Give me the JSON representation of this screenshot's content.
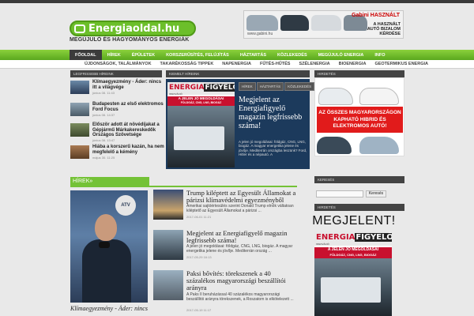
{
  "header": {
    "logo_text": "Energiaoldal.hu",
    "tagline": "MEGÚJULÓ ÉS HAGYOMÁNYOS ENERGIÁK",
    "ad": {
      "brand": "Gabini HASZNÁLT",
      "url": "www.gabini.hu",
      "slogan": "A HASZNÁLT AUTÓ BIZALOM KÉRDÉSE"
    }
  },
  "nav": {
    "items": [
      "FŐOLDAL",
      "HÍREK",
      "ÉPÜLETEK",
      "KORSZERŰSÍTÉS, FELÚJÍTÁS",
      "HÁZTARTÁS",
      "KÖZLEKEDÉS",
      "MEGÚJULÓ ENERGIA",
      "INFO"
    ],
    "active_index": 0
  },
  "subnav": {
    "items": [
      "ÚJDONSÁGOK, TALÁLMÁNYOK",
      "TAKARÉKOSSÁG TIPPEK",
      "NAPENERGIA",
      "FŰTÉS-HŰTÉS",
      "SZÉLENERGIA",
      "BIOENERGIA",
      "GEOTERMIKUS ENERGIA"
    ]
  },
  "latest": {
    "heading": "LEGFRISSEBB HÍREINK",
    "items": [
      {
        "title": "Klímaegyezmény - Áder: nincs itt a világvége",
        "date": "június 08. 11:43"
      },
      {
        "title": "Budapesten az első elektromos Ford Focus",
        "date": "június 08. 14:37"
      },
      {
        "title": "Először adott át növédíjakat a Gépjármű Márkakereskedők Országos Szövetsége",
        "date": "június 08. 13:47"
      },
      {
        "title": "Hiába a korszerű kazán, ha nem megfelelő a kémény",
        "date": "május 30. 11:25"
      }
    ]
  },
  "featured": {
    "heading": "KIEMELT HÍREINK",
    "tabs": [
      "HÍREK",
      "HÁZTARTÁS",
      "KÖZLEKEDÉS"
    ],
    "title": "Megjelent az Energiafigyelő magazin legfrissebb száma!",
    "text": "A jelen jó megoldásai: földgáz, CNG, LNG, biogáz. A magyar energetika jelene és jövője. Mediterrán országba leszünk? Ford, Hitler és a népautó. A"
  },
  "magazine": {
    "brand_a": "ENERGIA",
    "brand_b": "FIGYELŐ",
    "band": "A JELEN JÓ MEGOLDÁSAI",
    "band_sub": "FÖLDGÁZ, CNG, LNG, BIOGÁZ",
    "small_label": "INNOVÁCIÓ"
  },
  "ads": {
    "heading": "HIRDETÉS",
    "red_text": "AZ ÖSSZES MAGYARORSZÁGON KAPHATÓ HIBRID ÉS ELEKTROMOS AUTÓ!"
  },
  "news": {
    "heading": "HÍREK»",
    "big_caption": "Klímaegyezmény - Áder: nincs itt a világvége",
    "tv_logo": "ATV",
    "items": [
      {
        "title": "Trump kiléptett az Egyesült Államokat a párizsi klímavédelmi egyezményből",
        "excerpt": "Amerikai sajtóértesülés szerint Donald Trump elnök váltatoan kiléptető az Egyesült Államokat a párizsi ...",
        "date": "2017-06-01 11:21"
      },
      {
        "title": "Megjelent az Energiafigyelő magazin legfrissebb száma!",
        "excerpt": "A jelen jó megoldásai: földgáz, CNG, LNG, biogáz. A magyar energetika jelene és jövője. Mediterrán ország ...",
        "date": "2017-05-29 16:13"
      },
      {
        "title": "Paksi bővítés: törekszenek a 40 százalékos magyarországi beszállítói arányra",
        "excerpt": "A Paks II beruházással 40 százalékos magyarországi beszállítói arányra törekszenek, a Roszatom is elkötelezett ...",
        "date": "2017-05-19 11:17"
      }
    ]
  },
  "search": {
    "heading": "KERESÉS",
    "placeholder": "",
    "button": "Keresés"
  },
  "ads2": {
    "heading": "HIRDETÉS",
    "headline": "MEGJELENT!"
  },
  "colors": {
    "brand_green": "#74c236",
    "dark": "#444444",
    "red": "#c8102e"
  }
}
